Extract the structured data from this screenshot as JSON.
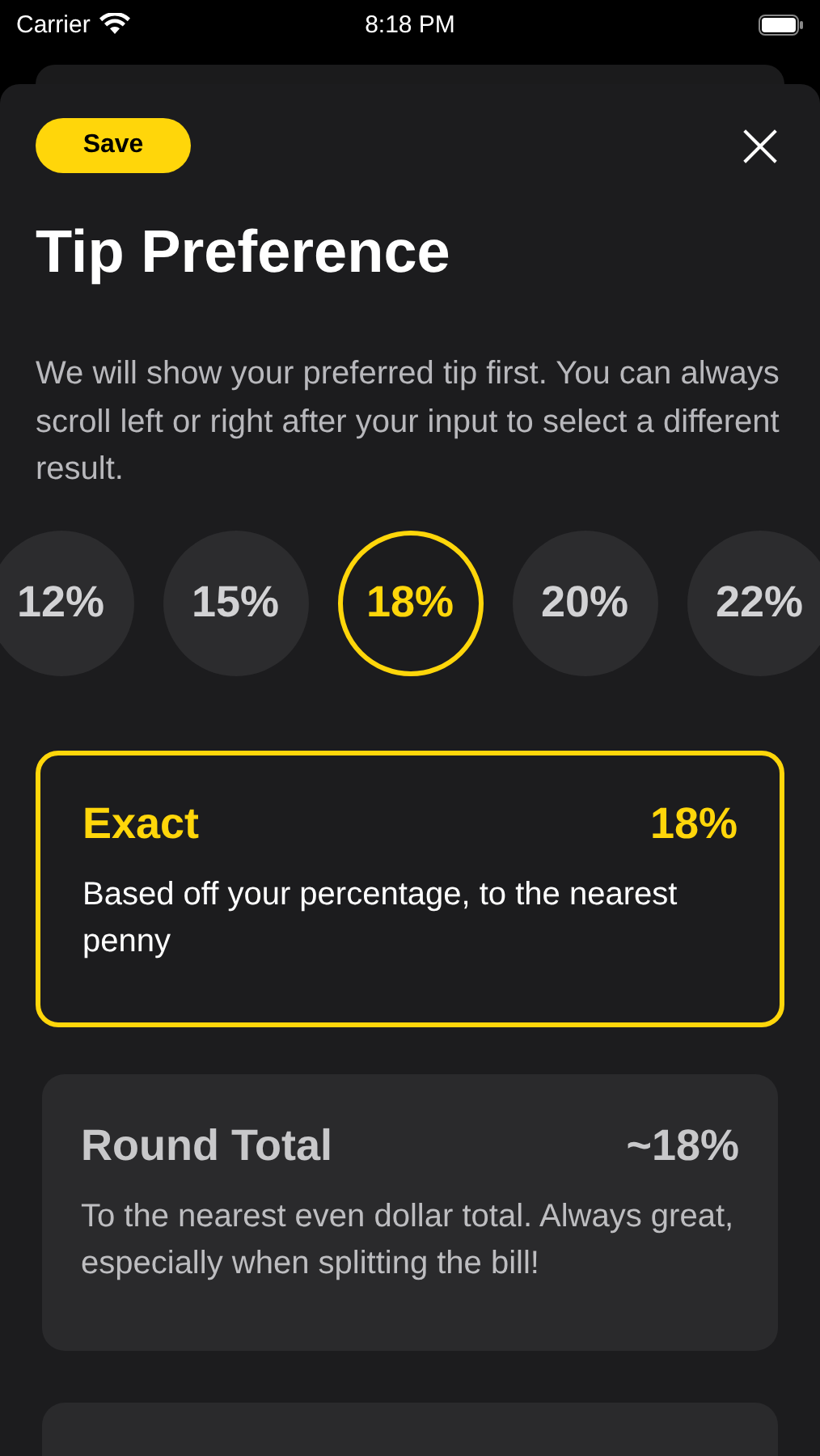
{
  "status_bar": {
    "carrier": "Carrier",
    "time": "8:18 PM"
  },
  "sheet": {
    "save_button": "Save",
    "close_button": "×",
    "title": "Tip Preference",
    "description": "We will show your preferred tip first. You can always scroll left or right after your input to select a different result."
  },
  "tip_options": [
    {
      "label": "12%",
      "selected": false
    },
    {
      "label": "15%",
      "selected": false
    },
    {
      "label": "18%",
      "selected": true
    },
    {
      "label": "20%",
      "selected": false
    },
    {
      "label": "22%",
      "selected": false
    }
  ],
  "rounding_options": [
    {
      "title": "Exact",
      "value": "18%",
      "description": "Based off your percentage, to the nearest penny",
      "selected": true
    },
    {
      "title": "Round Total",
      "value": "~18%",
      "description": "To the nearest even dollar total. Always great, especially when splitting the bill!",
      "selected": false
    }
  ]
}
